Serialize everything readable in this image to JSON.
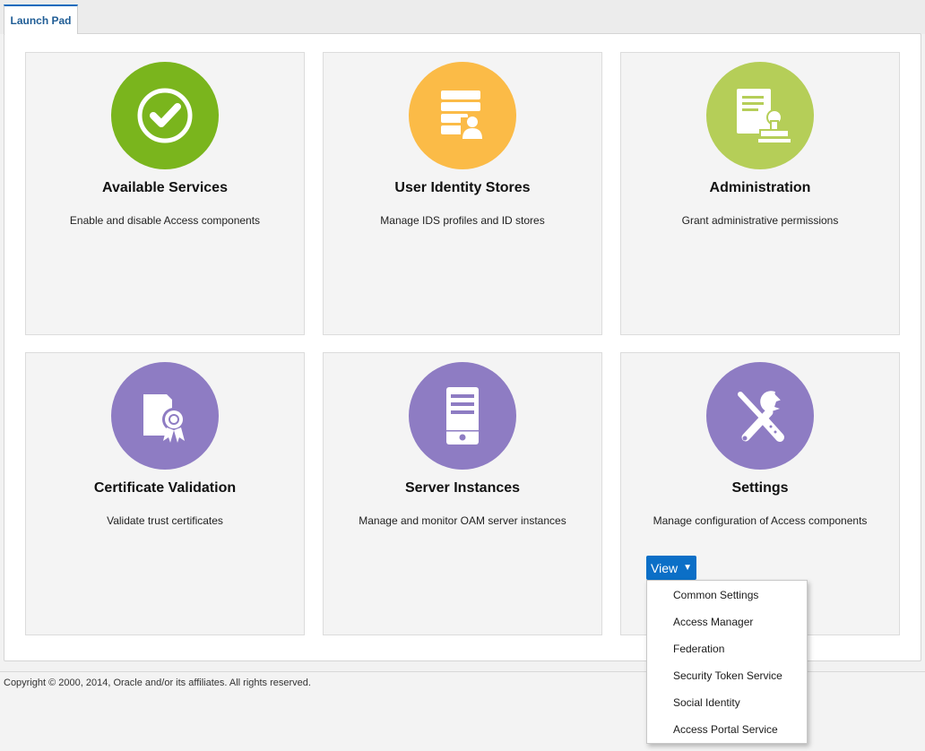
{
  "tabs": [
    {
      "label": "Launch Pad"
    }
  ],
  "tiles": [
    {
      "title": "Available Services",
      "description": "Enable and disable Access components",
      "icon": "checkmark-icon",
      "color": "#7ab51d"
    },
    {
      "title": "User Identity Stores",
      "description": "Manage IDS profiles and ID stores",
      "icon": "identity-store-icon",
      "color": "#fbbb47"
    },
    {
      "title": "Administration",
      "description": "Grant administrative permissions",
      "icon": "admin-document-stamp-icon",
      "color": "#b5ce58"
    },
    {
      "title": "Certificate Validation",
      "description": "Validate trust certificates",
      "icon": "certificate-icon",
      "color": "#8e7cc3"
    },
    {
      "title": "Server Instances",
      "description": "Manage and monitor OAM server instances",
      "icon": "server-icon",
      "color": "#8e7cc3"
    },
    {
      "title": "Settings",
      "description": "Manage configuration of Access components",
      "icon": "tools-icon",
      "color": "#8e7cc3"
    }
  ],
  "settings_menu": {
    "button_label": "View",
    "items": [
      {
        "label": "Common Settings"
      },
      {
        "label": "Access Manager"
      },
      {
        "label": "Federation"
      },
      {
        "label": "Security Token Service"
      },
      {
        "label": "Social Identity"
      },
      {
        "label": "Access Portal Service"
      }
    ]
  },
  "footer": {
    "copyright": "Copyright © 2000, 2014, Oracle and/or its affiliates. All rights reserved."
  }
}
